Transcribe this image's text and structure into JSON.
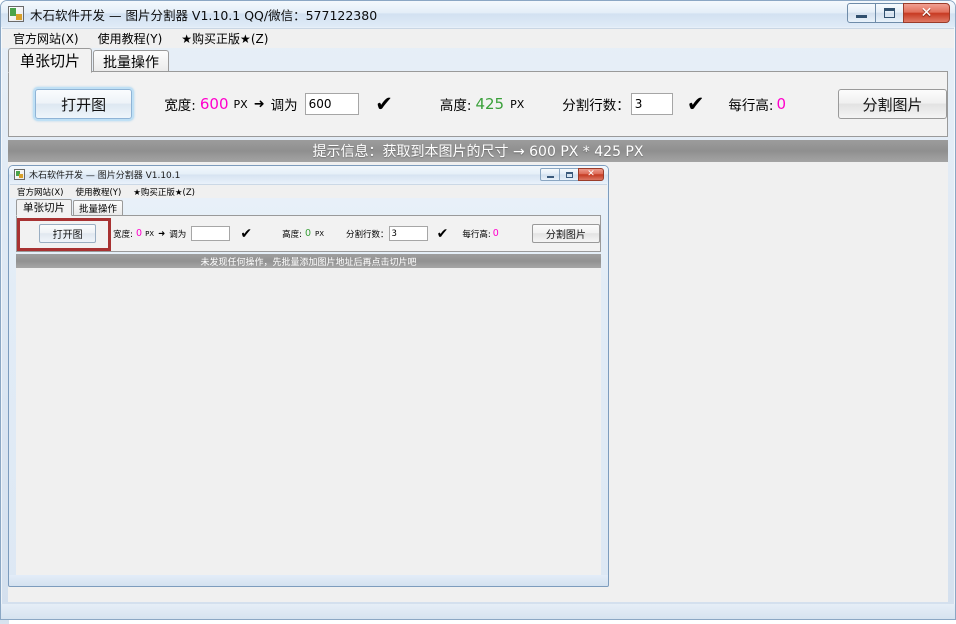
{
  "window": {
    "title": "木石软件开发 — 图片分割器 V1.10.1    QQ/微信：577122380",
    "icon": "app-icon",
    "controls": {
      "minimize": "—",
      "maximize": "❐",
      "close": "✕"
    }
  },
  "menubar": {
    "items": [
      {
        "label": "官方网站(X)"
      },
      {
        "label": "使用教程(Y)"
      },
      {
        "label": "★购买正版★(Z)"
      }
    ]
  },
  "tabs": [
    {
      "label": "单张切片",
      "active": true
    },
    {
      "label": "批量操作",
      "active": false
    }
  ],
  "toolbar": {
    "open_button": "打开图",
    "width_label": "宽度:",
    "width_value": "600",
    "width_unit": "PX",
    "arrow": "➜",
    "adjust_label": "调为",
    "adjust_value": "600",
    "check1": "✔",
    "height_label": "高度:",
    "height_value": "425",
    "height_unit": "PX",
    "rows_label": "分割行数：",
    "rows_value": "3",
    "check2": "✔",
    "rowheight_label": "每行高:",
    "rowheight_value": "0",
    "split_button": "分割图片"
  },
  "statusbar": {
    "text": "提示信息：获取到本图片的尺寸 → 600 PX * 425 PX"
  },
  "inner_window": {
    "title": "木石软件开发 — 图片分割器 V1.10.1",
    "controls": {
      "minimize": "—",
      "maximize": "❐",
      "close": "✕"
    },
    "menubar": {
      "items": [
        {
          "label": "官方网站(X)"
        },
        {
          "label": "使用教程(Y)"
        },
        {
          "label": "★购买正版★(Z)"
        }
      ]
    },
    "tabs": [
      {
        "label": "单张切片",
        "active": true
      },
      {
        "label": "批量操作",
        "active": false
      }
    ],
    "toolbar": {
      "open_button": "打开图",
      "width_label": "宽度:",
      "width_value": "0",
      "width_unit": "PX",
      "arrow": "➜",
      "adjust_label": "调为",
      "adjust_value": "",
      "check1": "✔",
      "height_label": "高度:",
      "height_value": "0",
      "height_unit": "PX",
      "rows_label": "分割行数：",
      "rows_value": "3",
      "check2": "✔",
      "rowheight_label": "每行高:",
      "rowheight_value": "0",
      "split_button": "分割图片"
    },
    "statusbar": {
      "text": "未发现任何操作，先批量添加图片地址后再点击切片吧"
    }
  },
  "colors": {
    "accent_pink": "#ff00cc",
    "accent_green": "#3aa03a",
    "status_bg": "#939393",
    "highlight_red": "#a83232",
    "focus_blue": "#bfe0f5"
  }
}
